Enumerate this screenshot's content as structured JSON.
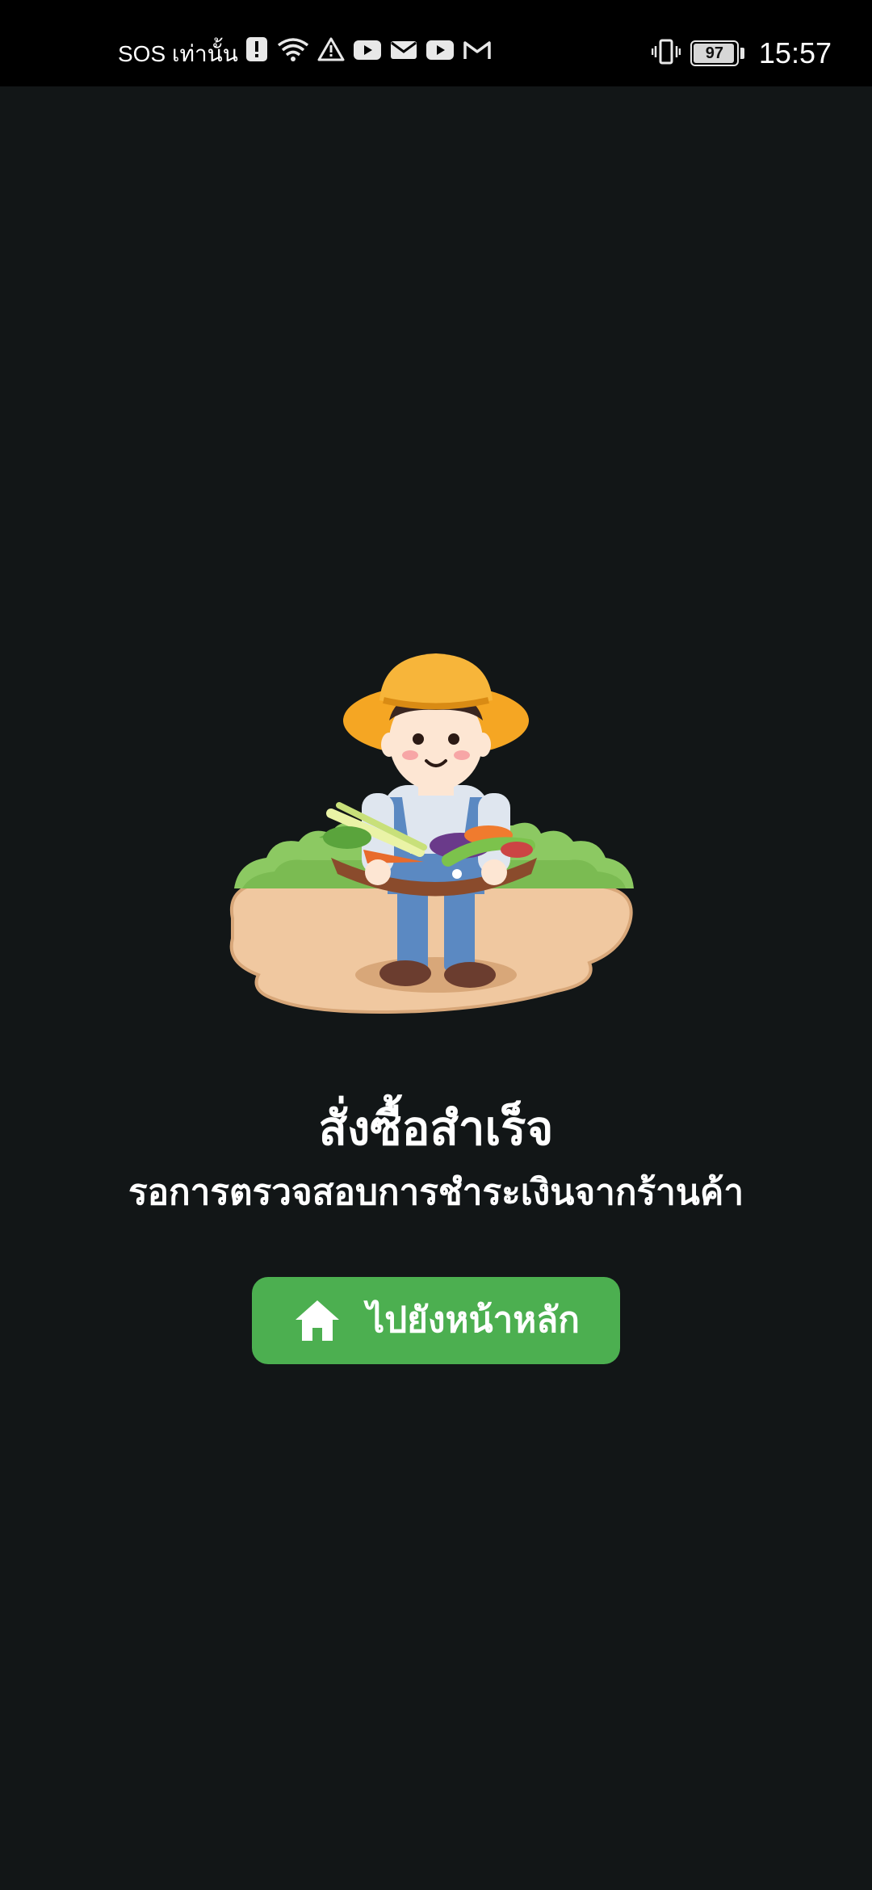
{
  "status_bar": {
    "network_text": "SOS เท่านั้น",
    "left_icons": [
      "alert-icon",
      "wifi-icon",
      "warning-icon",
      "youtube-icon",
      "mail-icon",
      "youtube-icon",
      "gmail-icon"
    ],
    "right_icons": [
      "vibrate-icon",
      "battery-icon"
    ],
    "battery_level": "97",
    "time": "15:57"
  },
  "main": {
    "title": "สั่งซื้อสำเร็จ",
    "subtitle": "รอการตรวจสอบการชำระเงินจากร้านค้า",
    "home_button": {
      "label": "ไปยังหน้าหลัก",
      "icon": "home-icon"
    }
  },
  "colors": {
    "background": "#121617",
    "status_bar": "#000000",
    "accent_button": "#4caf50",
    "text": "#ffffff"
  }
}
